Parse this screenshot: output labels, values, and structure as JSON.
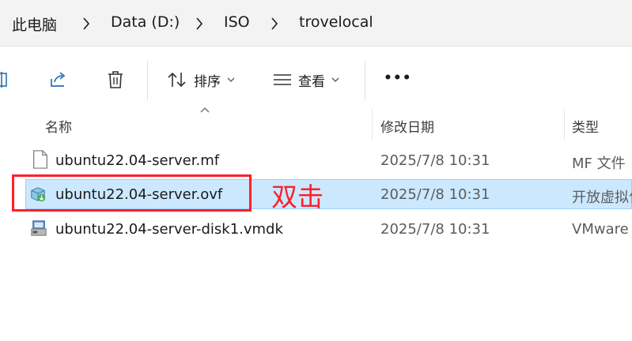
{
  "address_bar": {
    "crumbs": [
      "此电脑",
      "Data (D:)",
      "ISO",
      "trovelocal"
    ]
  },
  "toolbar": {
    "sort_label": "排序",
    "view_label": "查看",
    "more_label": "•••"
  },
  "columns": {
    "name": "名称",
    "date_modified": "修改日期",
    "type": "类型"
  },
  "files": [
    {
      "name": "ubuntu22.04-server.mf",
      "date": "2025/7/8 10:31",
      "type": "MF 文件",
      "icon": "text-file-icon",
      "selected": false
    },
    {
      "name": "ubuntu22.04-server.ovf",
      "date": "2025/7/8 10:31",
      "type": "开放虚拟化",
      "icon": "ovf-package-icon",
      "selected": true
    },
    {
      "name": "ubuntu22.04-server-disk1.vmdk",
      "date": "2025/7/8 10:31",
      "type": "VMware",
      "icon": "vmdk-disk-icon",
      "selected": false
    }
  ],
  "annotation": {
    "label": "双击",
    "color": "#ff1f2b"
  },
  "colors": {
    "selection_bg": "#cce8ff",
    "selection_border": "#99d1ff",
    "address_bg": "#f3f3f3"
  }
}
